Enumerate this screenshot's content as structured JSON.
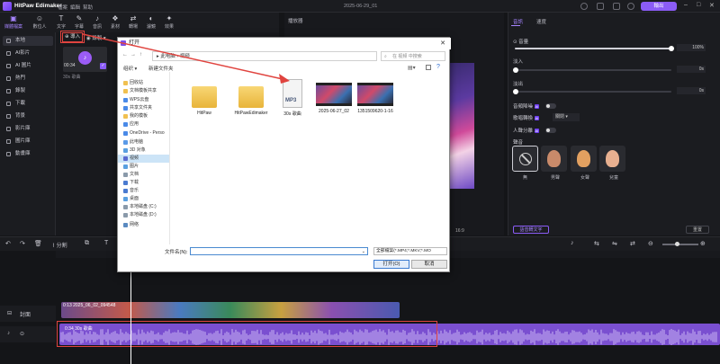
{
  "app": {
    "name": "HitPaw Edimaker",
    "project": "2025-06-29_01",
    "export_label": "輸出"
  },
  "menu": [
    "檔案",
    "編輯",
    "幫助"
  ],
  "toolbar": [
    {
      "label": "媒體檔案",
      "icon": "media-icon"
    },
    {
      "label": "數位人",
      "icon": "avatar-icon"
    },
    {
      "label": "文字",
      "icon": "text-icon"
    },
    {
      "label": "字幕",
      "icon": "subtitle-icon"
    },
    {
      "label": "音訊",
      "icon": "audio-icon"
    },
    {
      "label": "素材",
      "icon": "asset-icon"
    },
    {
      "label": "轉場",
      "icon": "transition-icon"
    },
    {
      "label": "濾鏡",
      "icon": "filter-icon"
    },
    {
      "label": "效果",
      "icon": "effect-icon"
    }
  ],
  "sidebar": [
    "本地",
    "AI影片",
    "AI 圖片",
    "熱門",
    "錄製",
    "下載",
    "背景",
    "影片庫",
    "圖片庫",
    "動畫庫"
  ],
  "media": {
    "import_label": "導入",
    "record_label": "錄製",
    "clip_duration": "00:34",
    "clip_name": "30s 歌曲"
  },
  "player": {
    "label": "播放器",
    "ratio": "16:9"
  },
  "right_panel": {
    "tabs": [
      "音訊",
      "速度"
    ],
    "volume": {
      "label": "音量",
      "value": "100%",
      "level": 1.0
    },
    "fade_in": {
      "label": "淡入",
      "value": "0s",
      "level": 0
    },
    "fade_out": {
      "label": "淡出",
      "value": "0s",
      "level": 0
    },
    "denoise_label": "音頻降噪",
    "voice_change": {
      "label": "歌唱轉換",
      "option": "關閉"
    },
    "vocal_sep_label": "人聲分離",
    "ai_badge": "AI",
    "voice_section": "聲音",
    "voices": [
      {
        "name": "無",
        "icon": "none-icon"
      },
      {
        "name": "男聲",
        "color": "#c98a6a"
      },
      {
        "name": "女聲",
        "color": "#e2a060"
      },
      {
        "name": "兒童",
        "color": "#e8b090"
      }
    ],
    "speech_to_text": "語音轉文字",
    "reset": "重置"
  },
  "timeline": {
    "split_label": "分割",
    "cover_label": "封面",
    "video_clip": "0:13 2025_06_02_094548",
    "audio_clip": "0:34 30s 歌曲"
  },
  "dialog": {
    "title": "打开",
    "path": [
      "此电脑",
      "视频"
    ],
    "search_placeholder": "在 视频 中搜索",
    "organize": "组织 ▾",
    "new_folder": "新建文件夹",
    "nav": [
      {
        "label": "回收站",
        "color": "#f0c050"
      },
      {
        "label": "文档模板共享",
        "color": "#f0c050"
      },
      {
        "label": "WPS云盘",
        "color": "#4a8ae8"
      },
      {
        "label": "共享文件夹",
        "color": "#4a8ae8"
      },
      {
        "label": "我的模板",
        "color": "#f0c050"
      },
      {
        "label": "应用",
        "color": "#4a8ae8"
      },
      {
        "label": "OneDrive - Perso",
        "color": "#4a8ae8"
      },
      {
        "label": "此电脑",
        "color": "#5a9ae8"
      },
      {
        "label": "3D 对象",
        "color": "#5aa0e0"
      },
      {
        "label": "视频",
        "color": "#5a6ad0"
      },
      {
        "label": "图片",
        "color": "#5aa0e0"
      },
      {
        "label": "文档",
        "color": "#8a9aaa"
      },
      {
        "label": "下载",
        "color": "#4a7ad0"
      },
      {
        "label": "音乐",
        "color": "#4a7ad0"
      },
      {
        "label": "桌面",
        "color": "#5aa0e0"
      },
      {
        "label": "本地磁盘 (C:)",
        "color": "#8a9aaa"
      },
      {
        "label": "本地磁盘 (D:)",
        "color": "#8a9aaa"
      },
      {
        "label": "网络",
        "color": "#5a8ac0"
      }
    ],
    "files": [
      {
        "name": "HitPaw",
        "kind": "folder"
      },
      {
        "name": "HitPawEdimaker",
        "kind": "folder"
      },
      {
        "name": "30s 歌曲",
        "kind": "mp3"
      },
      {
        "name": "2025-06-27_02",
        "kind": "video"
      },
      {
        "name": "1351509620-1-16",
        "kind": "video"
      }
    ],
    "filename_label": "文件名(N):",
    "filename_value": "",
    "filetype": "全部檔案(*.MP4;*.MKV;*.MO",
    "open_label": "打开(O)",
    "cancel_label": "取消"
  }
}
